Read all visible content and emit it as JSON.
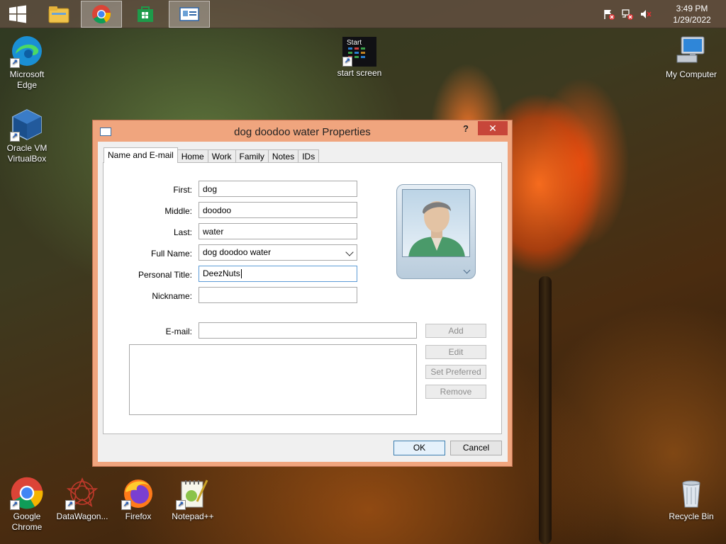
{
  "taskbar": {
    "clock_time": "3:49 PM",
    "clock_date": "1/29/2022",
    "buttons": [
      "windows-start-icon",
      "file-explorer-icon",
      "chrome-icon",
      "store-icon",
      "contacts-icon"
    ]
  },
  "desktop": {
    "edge": "Microsoft Edge",
    "virtualbox": "Oracle VM VirtualBox",
    "start_screen": "start screen",
    "start_tile": "Start",
    "my_computer": "My Computer",
    "chrome": "Google Chrome",
    "datawagon": "DataWagon...",
    "firefox": "Firefox",
    "notepadpp": "Notepad++",
    "recycle_bin": "Recycle Bin"
  },
  "dialog": {
    "title": "dog doodoo water Properties",
    "help": "?",
    "close": "✕",
    "tabs": [
      "Name and E-mail",
      "Home",
      "Work",
      "Family",
      "Notes",
      "IDs"
    ],
    "labels": {
      "first": "First:",
      "middle": "Middle:",
      "last": "Last:",
      "full_name": "Full Name:",
      "personal_title": "Personal Title:",
      "nickname": "Nickname:",
      "email": "E-mail:"
    },
    "values": {
      "first": "dog",
      "middle": "doodoo",
      "last": "water",
      "full_name": "dog doodoo water",
      "personal_title": "DeezNuts",
      "nickname": "",
      "email": ""
    },
    "side_buttons": {
      "add": "Add",
      "edit": "Edit",
      "set_preferred": "Set Preferred",
      "remove": "Remove"
    },
    "ok": "OK",
    "cancel": "Cancel"
  }
}
